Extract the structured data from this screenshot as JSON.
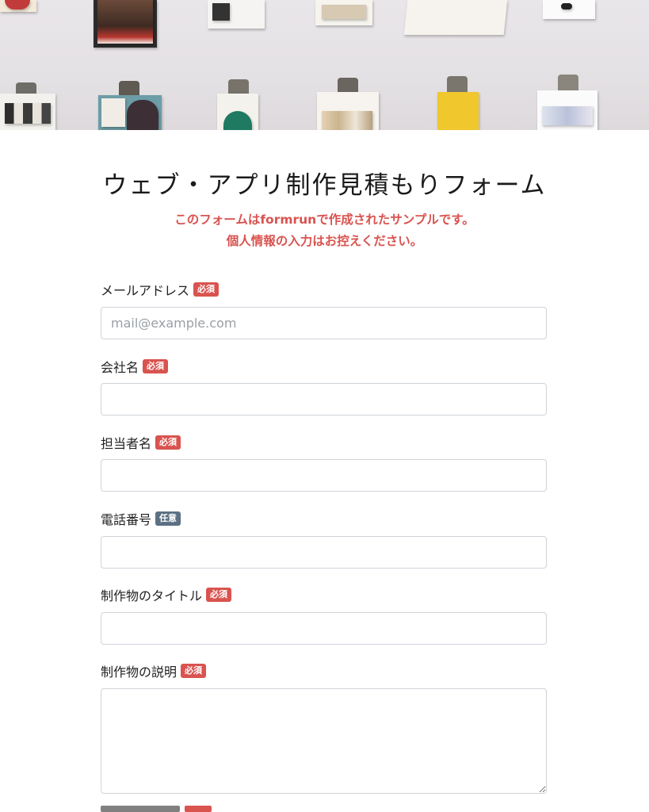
{
  "form": {
    "title": "ウェブ・アプリ制作見積もりフォーム",
    "notice_line1": "このフォームはformrunで作成されたサンプルです。",
    "notice_line2": "個人情報の入力はお控えください。"
  },
  "badges": {
    "required": "必須",
    "optional": "任意"
  },
  "fields": [
    {
      "label": "メールアドレス",
      "badge": "必須",
      "placeholder": "mail@example.com",
      "value": ""
    },
    {
      "label": "会社名",
      "badge": "必須",
      "placeholder": "",
      "value": ""
    },
    {
      "label": "担当者名",
      "badge": "必須",
      "placeholder": "",
      "value": ""
    },
    {
      "label": "電話番号",
      "badge": "任意",
      "placeholder": "",
      "value": ""
    },
    {
      "label": "制作物のタイトル",
      "badge": "必須",
      "placeholder": "",
      "value": ""
    },
    {
      "label": "制作物の説明",
      "badge": "必須",
      "placeholder": "",
      "value": ""
    }
  ],
  "colors": {
    "required_badge": "#d9534f",
    "optional_badge": "#5b7083",
    "notice_text": "#d9534f",
    "input_border": "#cfd4da"
  }
}
